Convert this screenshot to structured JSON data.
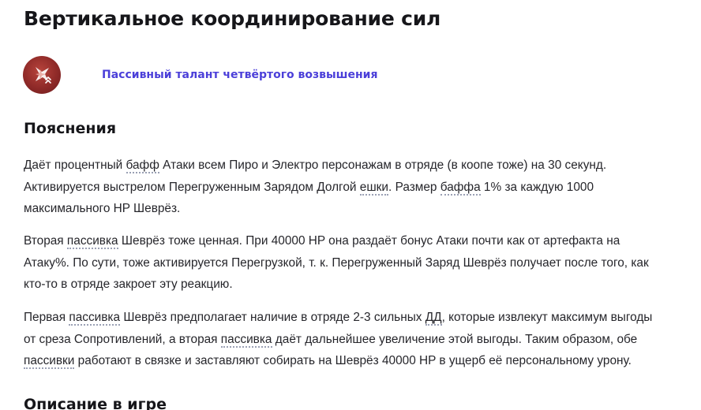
{
  "page": {
    "title": "Вертикальное координирование сил"
  },
  "talent": {
    "icon": "passive-talent-icon",
    "link_label": "Пассивный талант четвёртого возвышения",
    "icon_colors": {
      "bg_dark": "#6a1b1d",
      "bg_main": "#8f2a28",
      "glyph": "#ffffff"
    },
    "link_color": "#4b3fd9"
  },
  "explanations": {
    "heading": "Пояснения",
    "p1": {
      "t1": "Даёт процентный ",
      "term1": "бафф",
      "t2": " Атаки всем Пиро и Электро персонажам в отряде (в коопе тоже) на 30 секунд.",
      "t3": "Активируется выстрелом Перегруженным Зарядом Долгой ",
      "term2": "ешки",
      "t4": ". Размер ",
      "term3": "баффа",
      "t5": " 1% за каждую 1000",
      "t6": "максимального HP Шеврёз."
    },
    "p2": {
      "t1": "Вторая ",
      "term1": "пассивка",
      "t2": " Шеврёз тоже ценная. При 40000 HP она раздаёт бонус Атаки почти как от артефакта на",
      "t3": "Атаку%. По сути, тоже активируется Перегрузкой, т. к. Перегруженный Заряд Шеврёз получает после того, как",
      "t4": "кто-то в отряде закроет эту реакцию."
    },
    "p3": {
      "t1": "Первая ",
      "term1": "пассивка",
      "t2": " Шеврёз предполагает наличие в отряде 2-3 сильных ",
      "term2": "ДД",
      "t3": ", которые извлекут максимум выгоды",
      "t4": "от среза Сопротивлений, а вторая ",
      "term3": "пассивка",
      "t5": " даёт дальнейшее увеличение этой выгоды. Таким образом, обе",
      "term4": "пассивки",
      "t6": " работают в связке и заставляют собирать на Шеврёз 40000 HP в ущерб её персональному урону."
    }
  },
  "description": {
    "heading": "Описание в игре"
  }
}
